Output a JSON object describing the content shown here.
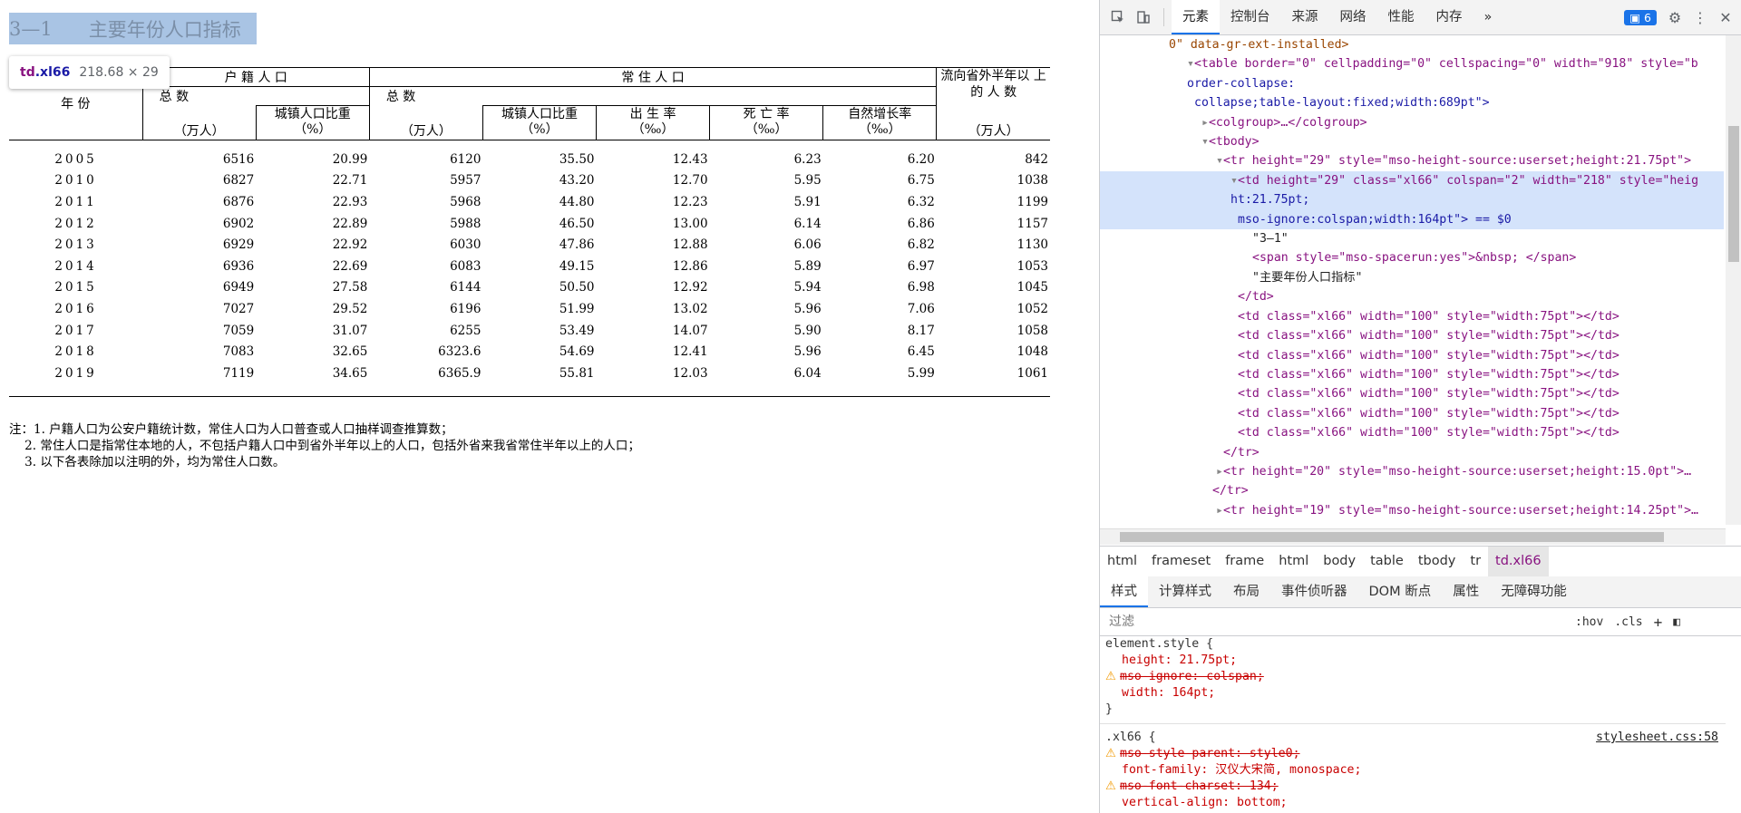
{
  "title": {
    "num": "3—1",
    "text": "主要年份人口指标"
  },
  "tooltip": {
    "tag": "td",
    "cls": ".xl66",
    "dims": "218.68 × 29"
  },
  "table": {
    "year_header": "年 份",
    "group_huji": "户 籍 人 口",
    "group_changzhu": "常 住 人 口",
    "outflow": "流向省外半年以 上 的 人 数",
    "total": "总 数",
    "unit_wan": "（万人）",
    "urban_ratio": "城镇人口比重",
    "unit_pct": "（%）",
    "birth_rate": "出 生 率",
    "death_rate": "死 亡 率",
    "growth_rate": "自然增长率",
    "unit_permil": "（‰）",
    "rows": [
      [
        "2005",
        "6516",
        "20.99",
        "6120",
        "35.50",
        "12.43",
        "6.23",
        "6.20",
        "842"
      ],
      [
        "2010",
        "6827",
        "22.71",
        "5957",
        "43.20",
        "12.70",
        "5.95",
        "6.75",
        "1038"
      ],
      [
        "2011",
        "6876",
        "22.93",
        "5968",
        "44.80",
        "12.23",
        "5.91",
        "6.32",
        "1199"
      ],
      [
        "2012",
        "6902",
        "22.89",
        "5988",
        "46.50",
        "13.00",
        "6.14",
        "6.86",
        "1157"
      ],
      [
        "2013",
        "6929",
        "22.92",
        "6030",
        "47.86",
        "12.88",
        "6.06",
        "6.82",
        "1130"
      ],
      [
        "2014",
        "6936",
        "22.69",
        "6083",
        "49.15",
        "12.86",
        "5.89",
        "6.97",
        "1053"
      ],
      [
        "2015",
        "6949",
        "27.58",
        "6144",
        "50.50",
        "12.92",
        "5.94",
        "6.98",
        "1045"
      ],
      [
        "2016",
        "7027",
        "29.52",
        "6196",
        "51.99",
        "13.02",
        "5.96",
        "7.06",
        "1052"
      ],
      [
        "2017",
        "7059",
        "31.07",
        "6255",
        "53.49",
        "14.07",
        "5.90",
        "8.17",
        "1058"
      ],
      [
        "2018",
        "7083",
        "32.65",
        "6323.6",
        "54.69",
        "12.41",
        "5.96",
        "6.45",
        "1048"
      ],
      [
        "2019",
        "7119",
        "34.65",
        "6365.9",
        "55.81",
        "12.03",
        "6.04",
        "5.99",
        "1061"
      ]
    ]
  },
  "notes": [
    "注：1. 户籍人口为公安户籍统计数，常住人口为人口普查或人口抽样调查推算数；",
    "    2. 常住人口是指常住本地的人，不包括户籍人口中到省外半年以上的人口，包括外省来我省常住半年以上的人口；",
    "    3. 以下各表除加以注明的外，均为常住人口数。"
  ],
  "devtools": {
    "tabs": [
      "元素",
      "控制台",
      "来源",
      "网络",
      "性能",
      "内存"
    ],
    "more": "»",
    "issues_count": "6",
    "crumbs": [
      "html",
      "frameset",
      "frame",
      "html",
      "body",
      "table",
      "tbody",
      "tr",
      "td.xl66"
    ],
    "subtabs": [
      "样式",
      "计算样式",
      "布局",
      "事件侦听器",
      "DOM 断点",
      "属性",
      "无障碍功能"
    ],
    "filter_placeholder": "过滤",
    "hov": ":hov",
    "cls": ".cls",
    "stylesheet_link": "stylesheet.css:58",
    "dom_lines": {
      "l1": "0\" data-gr-ext-installed>",
      "l2a": "<table border=\"0\" cellpadding=\"0\" cellspacing=\"0\" width=\"918\" style=\"b",
      "l2b": "order-collapse:",
      "l2c": "collapse;table-layout:fixed;width:689pt\">",
      "l3": "<colgroup>…</colgroup>",
      "l4": "<tbody>",
      "l5": "<tr height=\"29\" style=\"mso-height-source:userset;height:21.75pt\">",
      "l6a": "<td height=\"29\" class=\"xl66\" colspan=\"2\" width=\"218\" style=\"heig",
      "l6b": "ht:21.75pt;",
      "l6c": "mso-ignore:colspan;width:164pt\"> == $0",
      "l7": "\"3—1\"",
      "l8": "<span style=\"mso-spacerun:yes\">&nbsp; </span>",
      "l9": "\"主要年份人口指标\"",
      "l10": "</td>",
      "l11": "<td class=\"xl66\" width=\"100\" style=\"width:75pt\"></td>",
      "l12": "</tr>",
      "l13": "<tr height=\"20\" style=\"mso-height-source:userset;height:15.0pt\">…",
      "l14": "</tr>",
      "l15": "<tr height=\"19\" style=\"mso-height-source:userset;height:14.25pt\">…"
    },
    "styles": {
      "element_style": "element.style {",
      "height": "height: 21.75pt;",
      "mso_ignore": "mso-ignore: colspan;",
      "width": "width: 164pt;",
      "close": "}",
      "xl66": ".xl66 {",
      "msp": "mso-style-parent: style0;",
      "ff": "font-family: 汉仪大宋简, monospace;",
      "mfc": "mso-font-charset: 134;",
      "va": "vertical-align: bottom;"
    }
  }
}
